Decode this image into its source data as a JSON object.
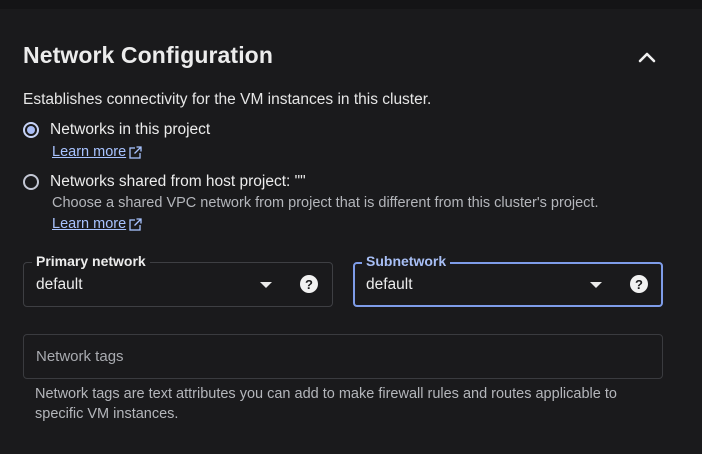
{
  "section": {
    "title": "Network Configuration",
    "description": "Establishes connectivity for the VM instances in this cluster.",
    "collapse_icon": "chevron-up-icon"
  },
  "network_options": [
    {
      "label": "Networks in this project",
      "selected": true,
      "learn_more": "Learn more"
    },
    {
      "label": "Networks shared from host project: \"\"",
      "selected": false,
      "description": "Choose a shared VPC network from project that is different from this cluster's project.",
      "learn_more": "Learn more"
    }
  ],
  "primary_network": {
    "label": "Primary network",
    "value": "default",
    "help_icon": "help-circle-icon"
  },
  "subnetwork": {
    "label": "Subnetwork",
    "value": "default",
    "help_icon": "help-circle-icon",
    "focused": true
  },
  "network_tags": {
    "placeholder": "Network tags",
    "hint": "Network tags are text attributes you can add to make firewall rules and routes applicable to specific VM instances."
  },
  "colors": {
    "background": "#1a1a1c",
    "accent": "#a8c3ff",
    "focus_border": "#7e9ce8",
    "radio_selected": "#a9bdf5"
  }
}
